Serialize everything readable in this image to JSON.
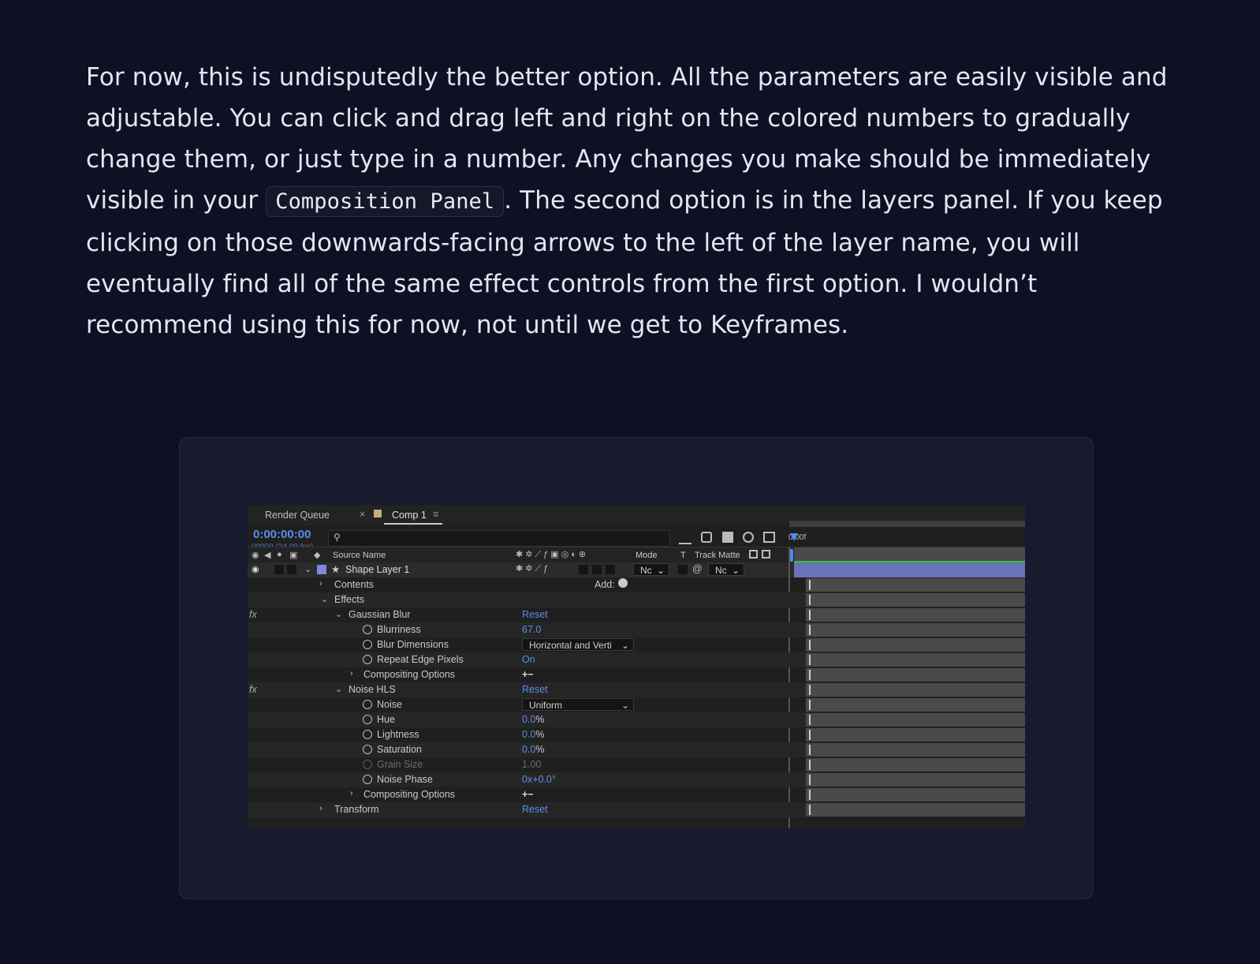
{
  "paragraph": {
    "part1": "For now, this is undisputedly the better option. All the parameters are easily visible and adjustable. You can click and drag left and right on the colored numbers to gradually change them, or just type in a number. Any changes you make should be immediately visible in your ",
    "code": "Composition Panel",
    "part2": ". The second option is in the layers panel. If you keep clicking on those downwards-facing arrows to the left of the layer name, you will eventually find all of the same effect controls from the first option. I wouldn’t recommend using this for now, not until we get to Keyframes."
  },
  "ae": {
    "tabs": {
      "render_queue": "Render Queue",
      "close": "×",
      "comp": "Comp 1",
      "menu": "≡"
    },
    "timecode": "0:00:00:00",
    "frames": "00000 (24.00 fps)",
    "time_marker": "0:00f",
    "headers": {
      "source_name": "Source Name",
      "mode": "Mode",
      "t": "T",
      "track_matte": "Track Matte"
    },
    "layer": {
      "name": "Shape Layer 1",
      "mode": "Nc",
      "matte": "Nc"
    },
    "rows": [
      {
        "label": "Contents",
        "value": "Add:"
      },
      {
        "label": "Effects",
        "value": ""
      },
      {
        "label": "Gaussian Blur",
        "value": "Reset"
      },
      {
        "label": "Blurriness",
        "value": "67.0"
      },
      {
        "label": "Blur Dimensions",
        "value": "Horizontal and Verti"
      },
      {
        "label": "Repeat Edge Pixels",
        "value": "On"
      },
      {
        "label": "Compositing Options",
        "value": "+−"
      },
      {
        "label": "Noise HLS",
        "value": "Reset"
      },
      {
        "label": "Noise",
        "value": "Uniform"
      },
      {
        "label": "Hue",
        "value": "0.0",
        "unit": "%"
      },
      {
        "label": "Lightness",
        "value": "0.0",
        "unit": "%"
      },
      {
        "label": "Saturation",
        "value": "0.0",
        "unit": "%"
      },
      {
        "label": "Grain Size",
        "value": "1.00"
      },
      {
        "label": "Noise Phase",
        "value": "0x+0.0°"
      },
      {
        "label": "Compositing Options",
        "value": "+−"
      },
      {
        "label": "Transform",
        "value": "Reset"
      }
    ],
    "fx": "fx"
  }
}
